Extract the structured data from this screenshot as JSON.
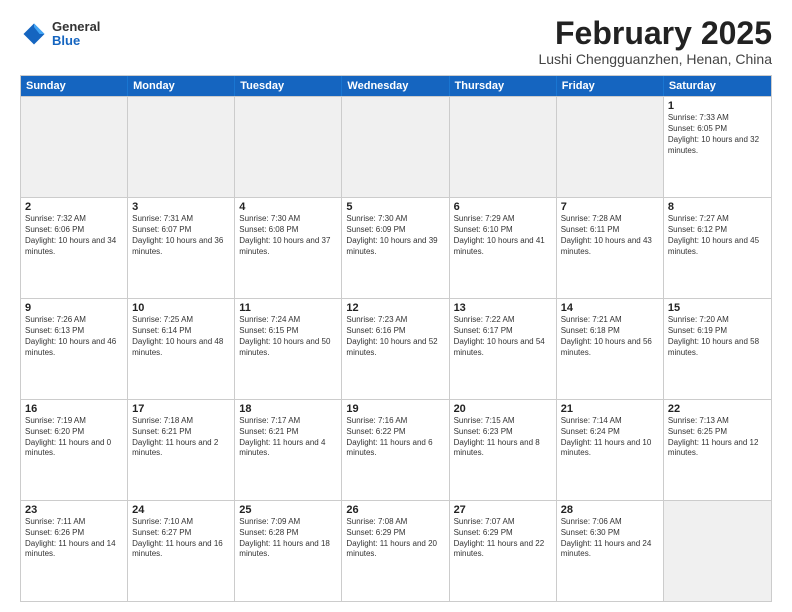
{
  "header": {
    "logo": {
      "line1": "General",
      "line2": "Blue"
    },
    "title": "February 2025",
    "location": "Lushi Chengguanzhen, Henan, China"
  },
  "calendar": {
    "days": [
      "Sunday",
      "Monday",
      "Tuesday",
      "Wednesday",
      "Thursday",
      "Friday",
      "Saturday"
    ],
    "rows": [
      [
        {
          "day": "",
          "info": ""
        },
        {
          "day": "",
          "info": ""
        },
        {
          "day": "",
          "info": ""
        },
        {
          "day": "",
          "info": ""
        },
        {
          "day": "",
          "info": ""
        },
        {
          "day": "",
          "info": ""
        },
        {
          "day": "1",
          "info": "Sunrise: 7:33 AM\nSunset: 6:05 PM\nDaylight: 10 hours and 32 minutes."
        }
      ],
      [
        {
          "day": "2",
          "info": "Sunrise: 7:32 AM\nSunset: 6:06 PM\nDaylight: 10 hours and 34 minutes."
        },
        {
          "day": "3",
          "info": "Sunrise: 7:31 AM\nSunset: 6:07 PM\nDaylight: 10 hours and 36 minutes."
        },
        {
          "day": "4",
          "info": "Sunrise: 7:30 AM\nSunset: 6:08 PM\nDaylight: 10 hours and 37 minutes."
        },
        {
          "day": "5",
          "info": "Sunrise: 7:30 AM\nSunset: 6:09 PM\nDaylight: 10 hours and 39 minutes."
        },
        {
          "day": "6",
          "info": "Sunrise: 7:29 AM\nSunset: 6:10 PM\nDaylight: 10 hours and 41 minutes."
        },
        {
          "day": "7",
          "info": "Sunrise: 7:28 AM\nSunset: 6:11 PM\nDaylight: 10 hours and 43 minutes."
        },
        {
          "day": "8",
          "info": "Sunrise: 7:27 AM\nSunset: 6:12 PM\nDaylight: 10 hours and 45 minutes."
        }
      ],
      [
        {
          "day": "9",
          "info": "Sunrise: 7:26 AM\nSunset: 6:13 PM\nDaylight: 10 hours and 46 minutes."
        },
        {
          "day": "10",
          "info": "Sunrise: 7:25 AM\nSunset: 6:14 PM\nDaylight: 10 hours and 48 minutes."
        },
        {
          "day": "11",
          "info": "Sunrise: 7:24 AM\nSunset: 6:15 PM\nDaylight: 10 hours and 50 minutes."
        },
        {
          "day": "12",
          "info": "Sunrise: 7:23 AM\nSunset: 6:16 PM\nDaylight: 10 hours and 52 minutes."
        },
        {
          "day": "13",
          "info": "Sunrise: 7:22 AM\nSunset: 6:17 PM\nDaylight: 10 hours and 54 minutes."
        },
        {
          "day": "14",
          "info": "Sunrise: 7:21 AM\nSunset: 6:18 PM\nDaylight: 10 hours and 56 minutes."
        },
        {
          "day": "15",
          "info": "Sunrise: 7:20 AM\nSunset: 6:19 PM\nDaylight: 10 hours and 58 minutes."
        }
      ],
      [
        {
          "day": "16",
          "info": "Sunrise: 7:19 AM\nSunset: 6:20 PM\nDaylight: 11 hours and 0 minutes."
        },
        {
          "day": "17",
          "info": "Sunrise: 7:18 AM\nSunset: 6:21 PM\nDaylight: 11 hours and 2 minutes."
        },
        {
          "day": "18",
          "info": "Sunrise: 7:17 AM\nSunset: 6:21 PM\nDaylight: 11 hours and 4 minutes."
        },
        {
          "day": "19",
          "info": "Sunrise: 7:16 AM\nSunset: 6:22 PM\nDaylight: 11 hours and 6 minutes."
        },
        {
          "day": "20",
          "info": "Sunrise: 7:15 AM\nSunset: 6:23 PM\nDaylight: 11 hours and 8 minutes."
        },
        {
          "day": "21",
          "info": "Sunrise: 7:14 AM\nSunset: 6:24 PM\nDaylight: 11 hours and 10 minutes."
        },
        {
          "day": "22",
          "info": "Sunrise: 7:13 AM\nSunset: 6:25 PM\nDaylight: 11 hours and 12 minutes."
        }
      ],
      [
        {
          "day": "23",
          "info": "Sunrise: 7:11 AM\nSunset: 6:26 PM\nDaylight: 11 hours and 14 minutes."
        },
        {
          "day": "24",
          "info": "Sunrise: 7:10 AM\nSunset: 6:27 PM\nDaylight: 11 hours and 16 minutes."
        },
        {
          "day": "25",
          "info": "Sunrise: 7:09 AM\nSunset: 6:28 PM\nDaylight: 11 hours and 18 minutes."
        },
        {
          "day": "26",
          "info": "Sunrise: 7:08 AM\nSunset: 6:29 PM\nDaylight: 11 hours and 20 minutes."
        },
        {
          "day": "27",
          "info": "Sunrise: 7:07 AM\nSunset: 6:29 PM\nDaylight: 11 hours and 22 minutes."
        },
        {
          "day": "28",
          "info": "Sunrise: 7:06 AM\nSunset: 6:30 PM\nDaylight: 11 hours and 24 minutes."
        },
        {
          "day": "",
          "info": ""
        }
      ]
    ]
  }
}
